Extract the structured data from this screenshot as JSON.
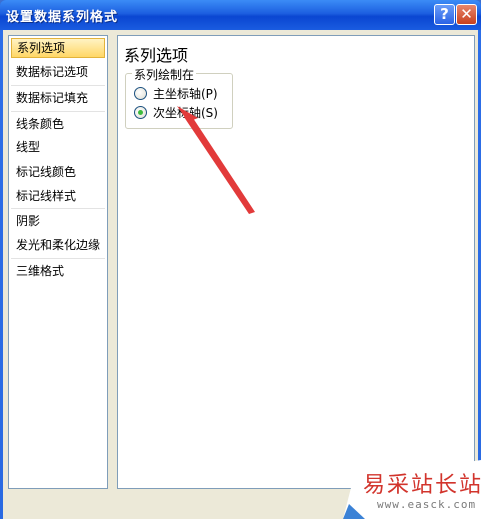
{
  "window": {
    "title": "设置数据系列格式",
    "help_label": "?",
    "close_label": "✕"
  },
  "sidebar": {
    "items": [
      {
        "label": "系列选项",
        "selected": true
      },
      {
        "label": "数据标记选项",
        "selected": false
      },
      {
        "label": "数据标记填充",
        "selected": false
      },
      {
        "label": "线条颜色",
        "selected": false
      },
      {
        "label": "线型",
        "selected": false
      },
      {
        "label": "标记线颜色",
        "selected": false
      },
      {
        "label": "标记线样式",
        "selected": false
      },
      {
        "label": "阴影",
        "selected": false
      },
      {
        "label": "发光和柔化边缘",
        "selected": false
      },
      {
        "label": "三维格式",
        "selected": false
      }
    ]
  },
  "content": {
    "title": "系列选项",
    "group": {
      "legend": "系列绘制在",
      "options": [
        {
          "label": "主坐标轴(P)",
          "checked": false
        },
        {
          "label": "次坐标轴(S)",
          "checked": true
        }
      ]
    }
  },
  "annotation": {
    "arrow_color": "#e23a3a"
  },
  "watermark": {
    "text": "易采站长站",
    "url": "www.easck.com"
  },
  "colors": {
    "titlebar": "#1c5fe0",
    "selected_item": "#ffd766",
    "radio_dot": "#3dbb3d"
  }
}
